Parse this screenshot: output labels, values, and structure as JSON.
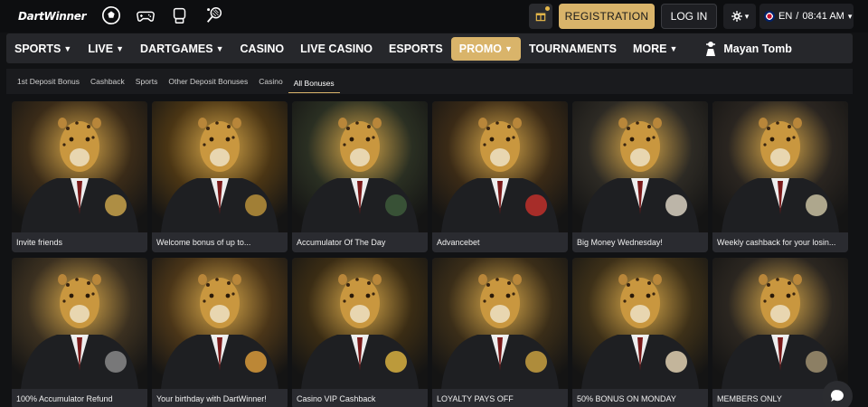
{
  "header": {
    "logo_text": "DartWinner",
    "icons": [
      "soccer-ball-icon",
      "gamepad-icon",
      "boxing-glove-icon",
      "tennis-racket-icon"
    ],
    "registration_label": "REGISTRATION",
    "login_label": "LOG IN",
    "language": "EN",
    "time": "08:41 AM"
  },
  "nav": {
    "items": [
      {
        "label": "SPORTS",
        "dropdown": true
      },
      {
        "label": "LIVE",
        "dropdown": true
      },
      {
        "label": "DARTGAMES",
        "dropdown": true
      },
      {
        "label": "CASINO",
        "dropdown": false
      },
      {
        "label": "LIVE CASINO",
        "dropdown": false
      },
      {
        "label": "ESPORTS",
        "dropdown": false
      },
      {
        "label": "PROMO",
        "dropdown": true,
        "active": true
      },
      {
        "label": "TOURNAMENTS",
        "dropdown": false
      },
      {
        "label": "MORE",
        "dropdown": true
      }
    ],
    "featured": "Mayan Tomb"
  },
  "subnav": {
    "items": [
      "1st Deposit Bonus",
      "Cashback",
      "Sports",
      "Other Deposit Bonuses",
      "Casino",
      "All Bonuses"
    ],
    "active_index": 5
  },
  "promos": [
    {
      "title": "Invite friends"
    },
    {
      "title": "Welcome bonus of up to..."
    },
    {
      "title": "Accumulator Of The Day"
    },
    {
      "title": "Advancebet"
    },
    {
      "title": "Big Money Wednesday!"
    },
    {
      "title": "Weekly cashback for your losin..."
    },
    {
      "title": "100% Accumulator Refund"
    },
    {
      "title": "Your birthday with DartWinner!"
    },
    {
      "title": "Casino VIP Cashback"
    },
    {
      "title": "LOYALTY PAYS OFF"
    },
    {
      "title": "50% BONUS ON MONDAY"
    },
    {
      "title": "MEMBERS ONLY"
    }
  ],
  "colors": {
    "accent": "#d9b46a",
    "background": "#111214",
    "nav_bg": "#26272b",
    "card_label_bg": "#2a2b30"
  }
}
